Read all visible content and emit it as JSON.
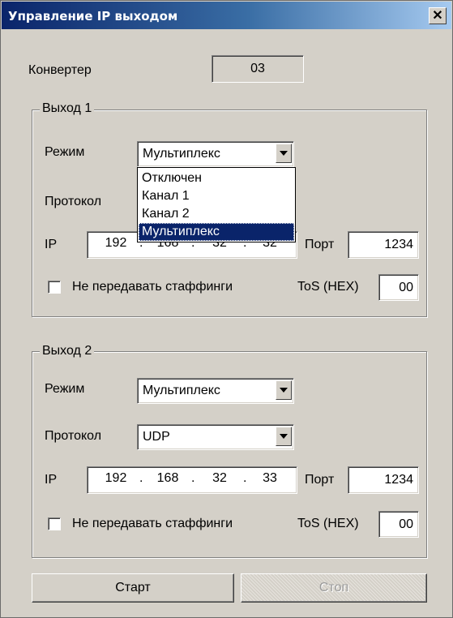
{
  "window": {
    "title": "Управление IP выходом",
    "close_symbol": "✕"
  },
  "converter": {
    "label": "Конвертер",
    "value": "03"
  },
  "output1": {
    "group_label": "Выход 1",
    "mode_label": "Режим",
    "mode_value": "Мультиплекс",
    "mode_options": [
      "Отключен",
      "Канал 1",
      "Канал 2",
      "Мультиплекс"
    ],
    "protocol_label": "Протокол",
    "ip_label": "IP",
    "ip": [
      "192",
      "168",
      "32",
      "32"
    ],
    "port_label": "Порт",
    "port_value": "1234",
    "stuffing_label": "Не передавать стаффинги",
    "stuffing_checked": false,
    "tos_label": "ToS (HEX)",
    "tos_value": "00"
  },
  "output2": {
    "group_label": "Выход 2",
    "mode_label": "Режим",
    "mode_value": "Мультиплекс",
    "protocol_label": "Протокол",
    "protocol_value": "UDP",
    "ip_label": "IP",
    "ip": [
      "192",
      "168",
      "32",
      "33"
    ],
    "port_label": "Порт",
    "port_value": "1234",
    "stuffing_label": "Не передавать стаффинги",
    "stuffing_checked": false,
    "tos_label": "ToS (HEX)",
    "tos_value": "00"
  },
  "buttons": {
    "start": "Старт",
    "stop": "Стоп"
  }
}
